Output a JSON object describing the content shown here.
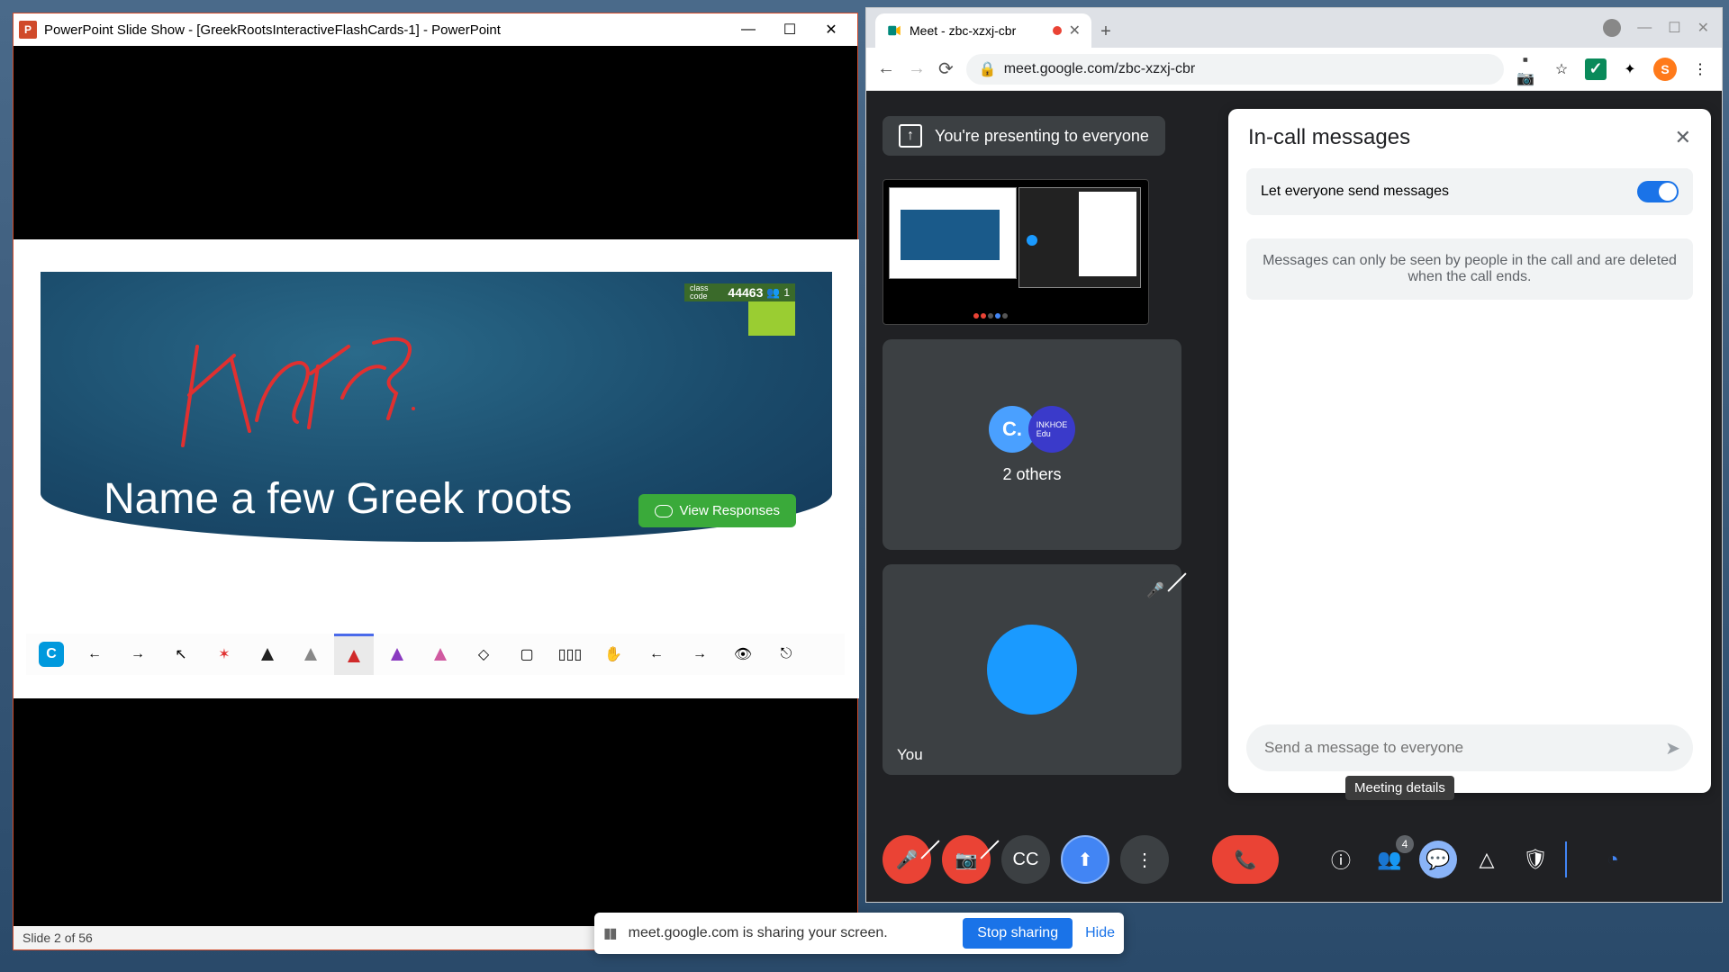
{
  "powerpoint": {
    "title": "PowerPoint Slide Show - [GreekRootsInteractiveFlashCards-1] - PowerPoint",
    "slide_text": "Name a few Greek roots",
    "view_responses": "View Responses",
    "class_code_label": "class code",
    "class_code": "44463",
    "participants": "1",
    "status": "Slide 2 of 56"
  },
  "chrome": {
    "tab_title": "Meet - zbc-xzxj-cbr",
    "url_display": "meet.google.com/zbc-xzxj-cbr",
    "avatar_letter": "S"
  },
  "meet": {
    "presenting": "You're presenting to everyone",
    "others_label": "2 others",
    "you_label": "You",
    "chat_title": "In-call messages",
    "chat_toggle_label": "Let everyone send messages",
    "chat_info": "Messages can only be seen by people in the call and are deleted when the call ends.",
    "chat_placeholder": "Send a message to everyone",
    "tooltip": "Meeting details",
    "badge": "4"
  },
  "share": {
    "text": "meet.google.com is sharing your screen.",
    "stop": "Stop sharing",
    "hide": "Hide"
  }
}
